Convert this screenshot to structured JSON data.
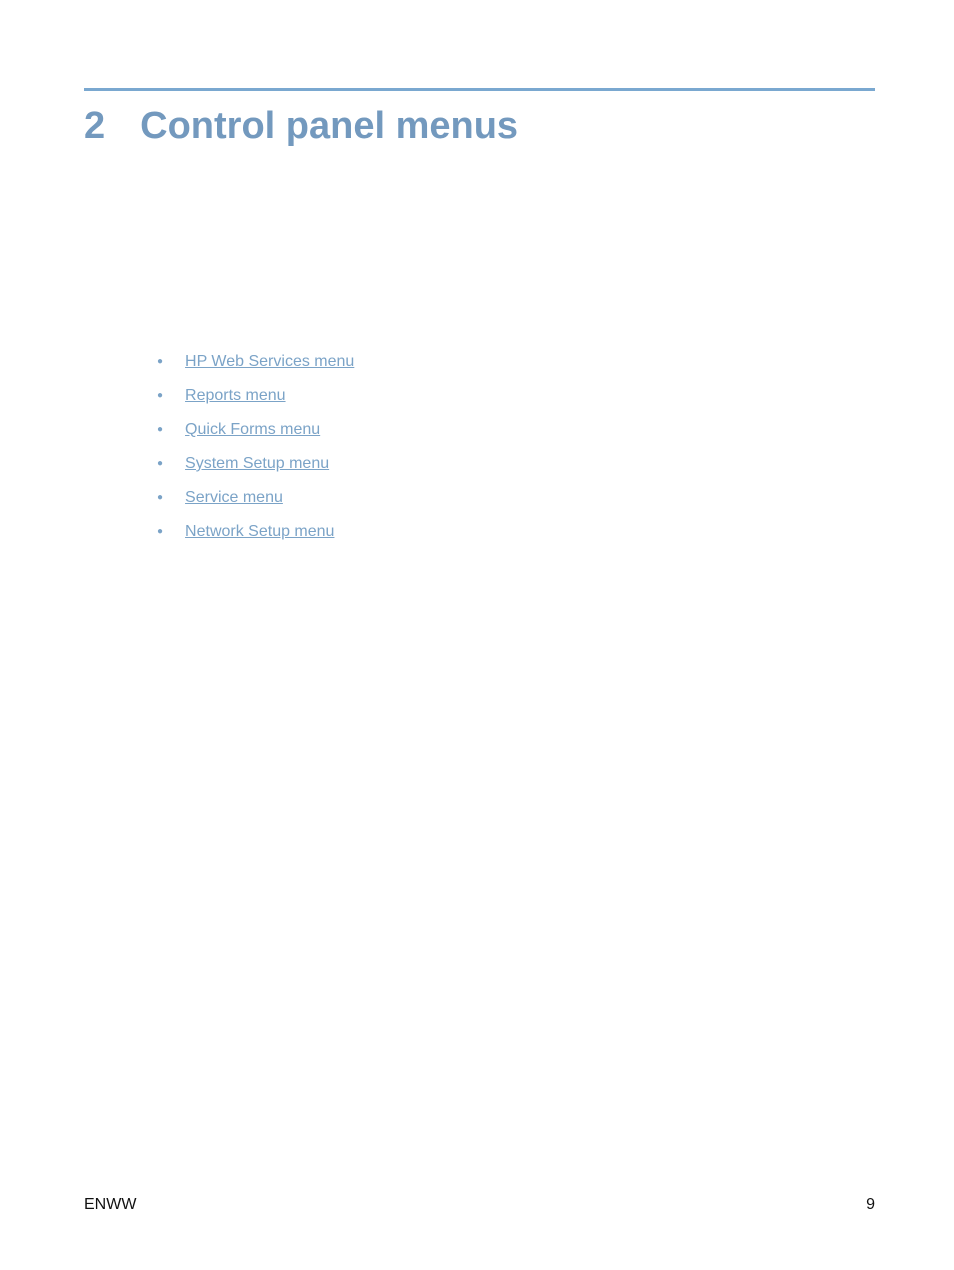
{
  "chapter": {
    "number": "2",
    "title": "Control panel menus"
  },
  "toc": {
    "items": [
      "HP Web Services menu",
      "Reports menu",
      "Quick Forms menu",
      "System Setup menu",
      "Service menu",
      "Network Setup menu"
    ]
  },
  "footer": {
    "left": "ENWW",
    "right": "9"
  }
}
